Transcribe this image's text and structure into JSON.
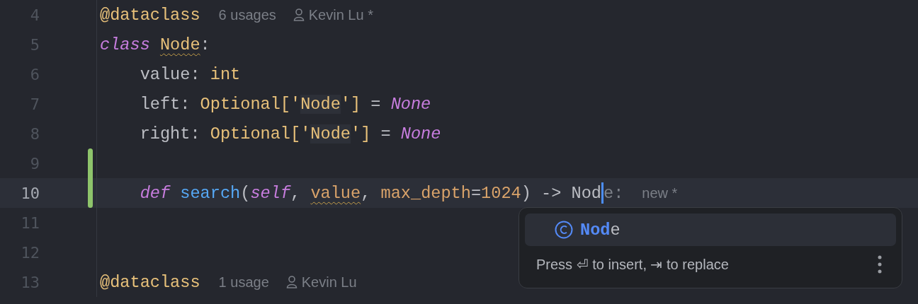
{
  "editor": {
    "lines": [
      {
        "number": "4",
        "current": false,
        "changed": false,
        "tokens": [
          {
            "text": "@dataclass",
            "kind": "decorator"
          }
        ],
        "hints": [
          {
            "text": "6 usages",
            "kind": "usages"
          },
          {
            "text": "Kevin Lu *",
            "kind": "author"
          }
        ]
      },
      {
        "number": "5",
        "current": false,
        "changed": false,
        "tokens": [
          {
            "text": "class ",
            "kind": "keyword"
          },
          {
            "text": "Node",
            "kind": "type",
            "squiggle": true
          },
          {
            "text": ":",
            "kind": "plain"
          }
        ]
      },
      {
        "number": "6",
        "current": false,
        "changed": false,
        "tokens": [
          {
            "text": "    value: ",
            "kind": "plain"
          },
          {
            "text": "int",
            "kind": "type"
          }
        ]
      },
      {
        "number": "7",
        "current": false,
        "changed": false,
        "tokens": [
          {
            "text": "    left: ",
            "kind": "plain"
          },
          {
            "text": "Optional['",
            "kind": "type"
          },
          {
            "text": "Node",
            "kind": "ref"
          },
          {
            "text": "']",
            "kind": "type"
          },
          {
            "text": " = ",
            "kind": "plain"
          },
          {
            "text": "None",
            "kind": "keyword"
          }
        ]
      },
      {
        "number": "8",
        "current": false,
        "changed": false,
        "tokens": [
          {
            "text": "    right: ",
            "kind": "plain"
          },
          {
            "text": "Optional['",
            "kind": "type"
          },
          {
            "text": "Node",
            "kind": "ref"
          },
          {
            "text": "']",
            "kind": "type"
          },
          {
            "text": " = ",
            "kind": "plain"
          },
          {
            "text": "None",
            "kind": "keyword"
          }
        ]
      },
      {
        "number": "9",
        "current": false,
        "changed": true
      },
      {
        "number": "10",
        "current": true,
        "changed": true,
        "tokens": [
          {
            "text": "    def ",
            "kind": "keyword"
          },
          {
            "text": "search",
            "kind": "func"
          },
          {
            "text": "(",
            "kind": "plain"
          },
          {
            "text": "self",
            "kind": "keyword"
          },
          {
            "text": ", ",
            "kind": "plain"
          },
          {
            "text": "value",
            "kind": "param",
            "squiggle": true
          },
          {
            "text": ", ",
            "kind": "plain"
          },
          {
            "text": "max_depth",
            "kind": "param"
          },
          {
            "text": "=",
            "kind": "plain"
          },
          {
            "text": "1024",
            "kind": "param"
          },
          {
            "text": ") -> Nod",
            "kind": "plain"
          },
          {
            "kind": "caret"
          },
          {
            "text": "e:",
            "kind": "ghost"
          }
        ],
        "hints": [
          {
            "text": "new *",
            "kind": "usages"
          }
        ]
      },
      {
        "number": "11",
        "current": false,
        "changed": false
      },
      {
        "number": "12",
        "current": false,
        "changed": false
      },
      {
        "number": "13",
        "current": false,
        "changed": false,
        "tokens": [
          {
            "text": "@dataclass",
            "kind": "decorator"
          }
        ],
        "hints": [
          {
            "text": "1 usage",
            "kind": "usages"
          },
          {
            "text": "Kevin Lu",
            "kind": "author"
          }
        ]
      }
    ]
  },
  "completion": {
    "items": [
      {
        "matched": "Nod",
        "rest": "e",
        "selected": true
      }
    ],
    "footer": "Press ⏎ to insert, ⇥ to replace"
  }
}
